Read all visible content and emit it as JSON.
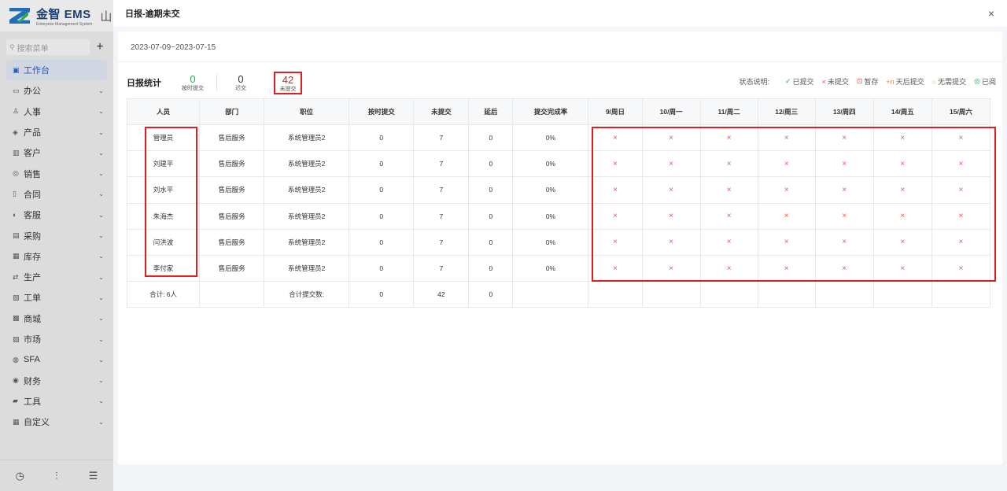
{
  "sidebar": {
    "logo_title": "金智 EMS",
    "logo_subtitle": "Enterprise Management System",
    "logo_extra": "山",
    "search_placeholder": "搜索菜单",
    "add_label": "+",
    "items": [
      {
        "label": "工作台",
        "icon": "▣",
        "active": true
      },
      {
        "label": "办公",
        "icon": "▭"
      },
      {
        "label": "人事",
        "icon": "♙"
      },
      {
        "label": "产品",
        "icon": "◈"
      },
      {
        "label": "客户",
        "icon": "▥"
      },
      {
        "label": "销售",
        "icon": "◎"
      },
      {
        "label": "合同",
        "icon": "▯"
      },
      {
        "label": "客服",
        "icon": "◐"
      },
      {
        "label": "采购",
        "icon": "▤"
      },
      {
        "label": "库存",
        "icon": "▦"
      },
      {
        "label": "生产",
        "icon": "⇄"
      },
      {
        "label": "工单",
        "icon": "▧"
      },
      {
        "label": "商城",
        "icon": "▩"
      },
      {
        "label": "市场",
        "icon": "▨"
      },
      {
        "label": "SFA",
        "icon": "◍"
      },
      {
        "label": "财务",
        "icon": "◉"
      },
      {
        "label": "工具",
        "icon": "▰"
      },
      {
        "label": "自定义",
        "icon": "▦"
      }
    ]
  },
  "panel": {
    "title": "日报-逾期未交",
    "close": "×",
    "date_range": "2023-07-09~2023-07-15"
  },
  "stats": {
    "label": "日报统计",
    "ontime": {
      "value": "0",
      "label": "按时提交"
    },
    "late": {
      "value": "0",
      "label": "迟交"
    },
    "missing": {
      "value": "42",
      "label": "未提交"
    }
  },
  "legend": {
    "title": "状态说明:",
    "items": [
      {
        "symbol": "✓",
        "label": "已提交",
        "color": "#2aa55a"
      },
      {
        "symbol": "×",
        "label": "未提交",
        "color": "#e05555"
      },
      {
        "symbol": "⊡",
        "label": "暂存",
        "color": "#e05555"
      },
      {
        "symbol": "+n",
        "label": "天后提交",
        "color": "#e8833a"
      },
      {
        "symbol": "○",
        "label": "无需提交",
        "color": "#e8a23a"
      },
      {
        "symbol": "◎",
        "label": "已阅",
        "color": "#2aa55a"
      }
    ]
  },
  "table": {
    "headers": [
      "人员",
      "部门",
      "职位",
      "按时提交",
      "未提交",
      "延后",
      "提交完成率",
      "9/周日",
      "10/周一",
      "11/周二",
      "12/周三",
      "13/周四",
      "14/周五",
      "15/周六"
    ],
    "rows": [
      {
        "name": "管理员",
        "dept": "售后服务",
        "position": "系统管理员2",
        "ontime": "0",
        "missing": "7",
        "late": "0",
        "rate": "0%",
        "days": [
          "×",
          "×",
          "×",
          "×",
          "×",
          "×",
          "×"
        ]
      },
      {
        "name": "刘建平",
        "dept": "售后服务",
        "position": "系统管理员2",
        "ontime": "0",
        "missing": "7",
        "late": "0",
        "rate": "0%",
        "days": [
          "×",
          "×",
          "×",
          "×",
          "×",
          "×",
          "×"
        ]
      },
      {
        "name": "刘水平",
        "dept": "售后服务",
        "position": "系统管理员2",
        "ontime": "0",
        "missing": "7",
        "late": "0",
        "rate": "0%",
        "days": [
          "×",
          "×",
          "×",
          "×",
          "×",
          "×",
          "×"
        ]
      },
      {
        "name": "朱海杰",
        "dept": "售后服务",
        "position": "系统管理员2",
        "ontime": "0",
        "missing": "7",
        "late": "0",
        "rate": "0%",
        "days": [
          "×",
          "×",
          "×",
          "×",
          "×",
          "×",
          "×"
        ]
      },
      {
        "name": "闫洪波",
        "dept": "售后服务",
        "position": "系统管理员2",
        "ontime": "0",
        "missing": "7",
        "late": "0",
        "rate": "0%",
        "days": [
          "×",
          "×",
          "×",
          "×",
          "×",
          "×",
          "×"
        ]
      },
      {
        "name": "李付家",
        "dept": "售后服务",
        "position": "系统管理员2",
        "ontime": "0",
        "missing": "7",
        "late": "0",
        "rate": "0%",
        "days": [
          "×",
          "×",
          "×",
          "×",
          "×",
          "×",
          "×"
        ]
      }
    ],
    "total": {
      "people": "合计: 6人",
      "label": "合计提交数:",
      "ontime": "0",
      "missing": "42",
      "late": "0"
    }
  }
}
